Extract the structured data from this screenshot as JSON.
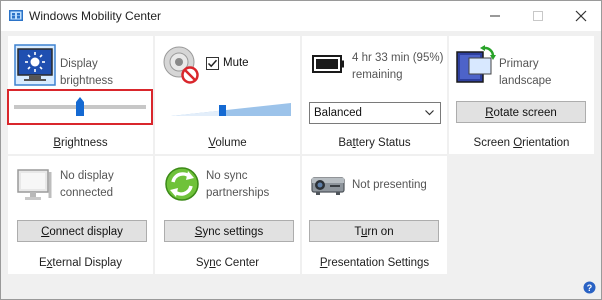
{
  "window": {
    "title": "Windows Mobility Center",
    "controls": [
      "minimize",
      "maximize",
      "close"
    ]
  },
  "tiles": {
    "brightness": {
      "status": "Display brightness",
      "label_pre": "",
      "label_key": "B",
      "label_post": "rightness",
      "slider_level": 0.55
    },
    "volume": {
      "mute_label": "Mute",
      "mute_checked": true,
      "label_pre": "",
      "label_key": "V",
      "label_post": "olume",
      "slider_level": 0.4
    },
    "battery": {
      "status_line1": "4 hr 33 min (95%)",
      "status_line2": "remaining",
      "plan_value": "Balanced",
      "label_pre": "Ba",
      "label_key": "t",
      "label_post": "tery Status"
    },
    "orientation": {
      "status": "Primary landscape",
      "button_pre": "",
      "button_key": "R",
      "button_post": "otate screen",
      "label_pre": "Screen ",
      "label_key": "O",
      "label_post": "rientation"
    },
    "external_display": {
      "status_line1": "No display",
      "status_line2": "connected",
      "button_pre": "",
      "button_key": "C",
      "button_post": "onnect display",
      "label_pre": "E",
      "label_key": "x",
      "label_post": "ternal Display"
    },
    "sync_center": {
      "status_line1": "No sync",
      "status_line2": "partnerships",
      "button_pre": "",
      "button_key": "S",
      "button_post": "ync settings",
      "label_pre": "Sy",
      "label_key": "n",
      "label_post": "c Center"
    },
    "presentation": {
      "status": "Not presenting",
      "button_pre": "T",
      "button_key": "u",
      "button_post": "rn on",
      "label_pre": "",
      "label_key": "P",
      "label_post": "resentation Settings"
    }
  },
  "colors": {
    "highlight": "#d9262c",
    "slider_thumb": "#1469d2",
    "slider_track": "#c7c7c7",
    "volume_fill": "#9cc3ea"
  },
  "icons": {
    "brightness": "display-brightness-icon",
    "volume": "speaker-muted-icon",
    "battery": "battery-icon",
    "orientation": "rotate-display-icon",
    "external_display": "monitor-icon",
    "sync": "sync-icon",
    "presentation": "projector-icon",
    "help": "help-icon"
  }
}
